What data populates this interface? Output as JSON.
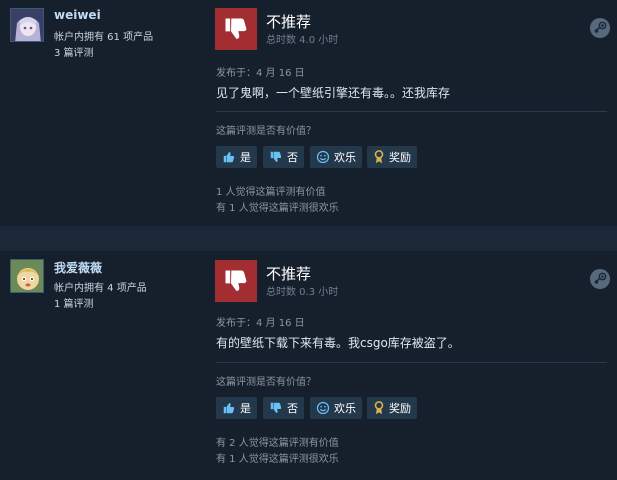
{
  "colors": {
    "background": "#1b2838",
    "card": "#16202d",
    "thumb_down": "#a32e32",
    "button": "#24384c",
    "username": "#c1dbf4",
    "award_gold": "#d9b24a"
  },
  "reviews": [
    {
      "user": {
        "name": "weiwei",
        "owned": "帐户内拥有 61 项产品",
        "review_count": "3 篇评测",
        "avatar": "anime-avatar-icon"
      },
      "verdict": "不推荐",
      "hours": "总时数 4.0 小时",
      "posted": "发布于：4 月 16 日",
      "text": "见了鬼啊，一个壁纸引擎还有毒。。还我库存",
      "helpful_question": "这篇评测是否有价值？",
      "buttons": {
        "yes": "是",
        "no": "否",
        "funny": "欢乐",
        "award": "奖励"
      },
      "stats": [
        "1 人觉得这篇评测有价值",
        "有 1 人觉得这篇评测很欢乐"
      ]
    },
    {
      "user": {
        "name": "我爱薇薇",
        "owned": "帐户内拥有 4 项产品",
        "review_count": "1 篇评测",
        "avatar": "cartoon-avatar-icon"
      },
      "verdict": "不推荐",
      "hours": "总时数 0.3 小时",
      "posted": "发布于：4 月 16 日",
      "text": "有的壁纸下载下来有毒。我csgo库存被盗了。",
      "helpful_question": "这篇评测是否有价值？",
      "buttons": {
        "yes": "是",
        "no": "否",
        "funny": "欢乐",
        "award": "奖励"
      },
      "stats": [
        "有 2 人觉得这篇评测有价值",
        "有 1 人觉得这篇评测很欢乐"
      ]
    }
  ]
}
